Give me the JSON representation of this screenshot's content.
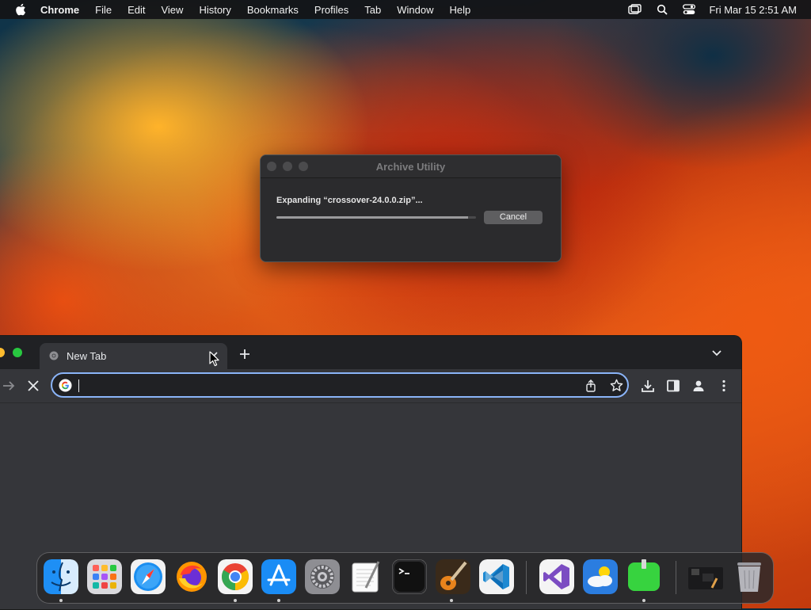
{
  "menubar": {
    "app_name": "Chrome",
    "items": [
      "File",
      "Edit",
      "View",
      "History",
      "Bookmarks",
      "Profiles",
      "Tab",
      "Window",
      "Help"
    ],
    "clock": "Fri Mar 15  2:51 AM"
  },
  "dialog": {
    "title": "Archive Utility",
    "message": "Expanding “crossover-24.0.0.zip”...",
    "progress": 0.96,
    "cancel_label": "Cancel"
  },
  "browser": {
    "tab_title": "New Tab",
    "omnibox_value": "",
    "accent_color": "#8ab4f8"
  },
  "dock": {
    "icons": [
      "finder-icon",
      "launchpad-icon",
      "safari-icon",
      "firefox-icon",
      "chrome-icon",
      "app-store-icon",
      "system-settings-icon",
      "textedit-icon",
      "terminal-icon",
      "garageband-icon",
      "vscode-icon",
      "visual-studio-icon",
      "weather-icon",
      "gpu-monitor-icon",
      "downloads-stack-icon",
      "trash-icon"
    ]
  }
}
